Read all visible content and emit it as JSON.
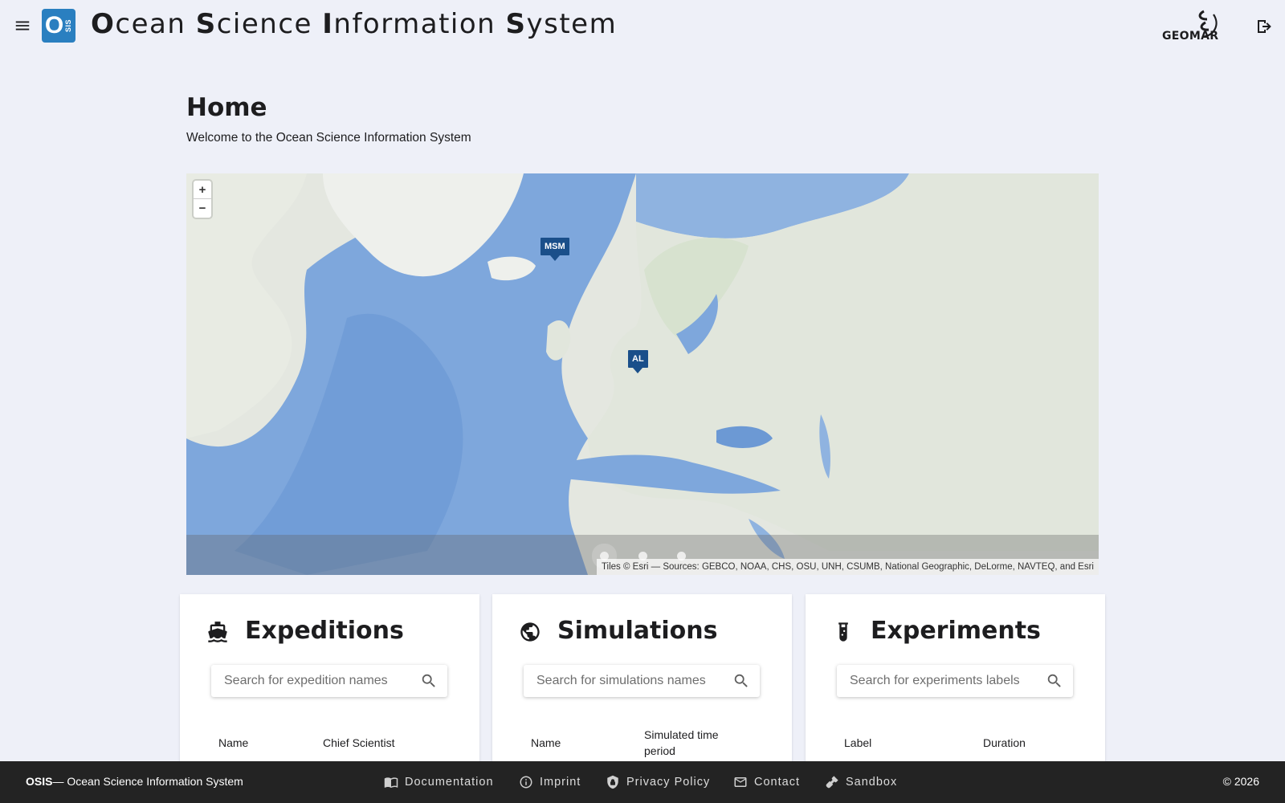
{
  "app": {
    "title_parts": [
      {
        "initial": "O",
        "rest": "cean "
      },
      {
        "initial": "S",
        "rest": "cience "
      },
      {
        "initial": "I",
        "rest": "nformation "
      },
      {
        "initial": "S",
        "rest": "ystem"
      }
    ],
    "logo_letter": "O",
    "logo_sub": "SIS",
    "partner_logo": "GEOMAR",
    "icons": {
      "menu": "menu-icon",
      "logout": "logout-icon"
    }
  },
  "page": {
    "title": "Home",
    "subtitle": "Welcome to the Ocean Science Information System"
  },
  "map": {
    "zoom_in": "+",
    "zoom_out": "−",
    "markers": [
      {
        "label": "MSM"
      },
      {
        "label": "AL"
      }
    ],
    "carousel_dots": 3,
    "active_dot": 0,
    "attribution": "Tiles © Esri — Sources: GEBCO, NOAA, CHS, OSU, UNH, CSUMB, National Geographic, DeLorme, NAVTEQ, and Esri",
    "colors": {
      "ocean": "#7fa8de",
      "deep_ocean": "#6b9ad6",
      "land": "#e3e7dd",
      "marker": "#1a4f8a"
    }
  },
  "cards": {
    "expeditions": {
      "icon": "ship-icon",
      "title": "Expeditions",
      "search_placeholder": "Search for expedition names",
      "columns": [
        "Name",
        "Chief Scientist"
      ]
    },
    "simulations": {
      "icon": "globe-icon",
      "title": "Simulations",
      "search_placeholder": "Search for simulations names",
      "columns": [
        "Name",
        "Simulated time period"
      ]
    },
    "experiments": {
      "icon": "test-tube-icon",
      "title": "Experiments",
      "search_placeholder": "Search for experiments labels",
      "columns": [
        "Label",
        "Duration"
      ]
    }
  },
  "footer": {
    "brand_bold": "OSIS",
    "brand_rest": "— Ocean Science Information System",
    "links": [
      {
        "label": "Documentation",
        "icon": "book-icon"
      },
      {
        "label": "Imprint",
        "icon": "info-icon"
      },
      {
        "label": "Privacy Policy",
        "icon": "shield-icon"
      },
      {
        "label": "Contact",
        "icon": "mail-icon"
      },
      {
        "label": "Sandbox",
        "icon": "shovel-icon"
      }
    ],
    "copyright": "© 2026"
  }
}
